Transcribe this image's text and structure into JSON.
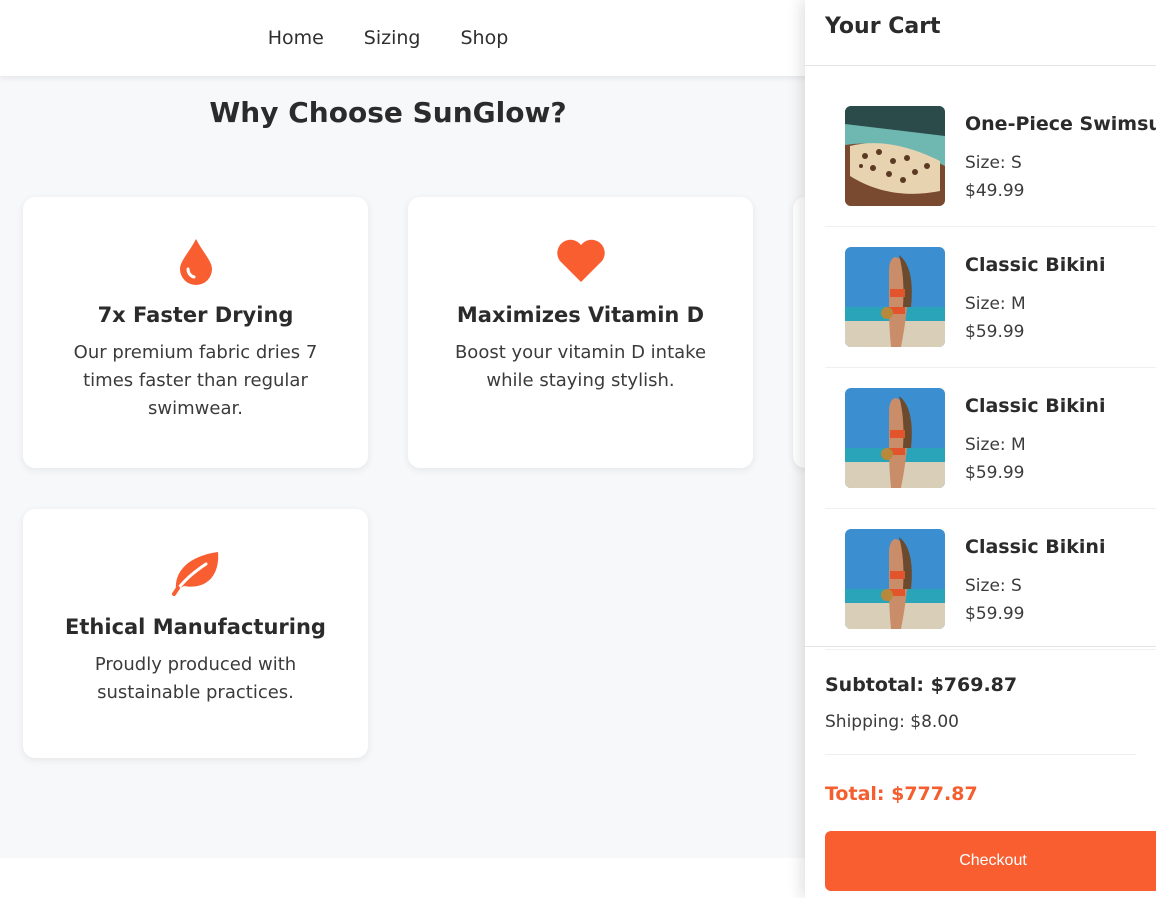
{
  "colors": {
    "accent": "#f95e31",
    "background": "#f7f8fa",
    "card": "#ffffff"
  },
  "nav": {
    "items": [
      {
        "label": "Home"
      },
      {
        "label": "Sizing"
      },
      {
        "label": "Shop"
      }
    ]
  },
  "features": {
    "title": "Why Choose SunGlow?",
    "cards": [
      {
        "icon": "water-drop-icon",
        "title": "7x Faster Drying",
        "text": "Our premium fabric dries 7 times faster than regular swimwear."
      },
      {
        "icon": "heart-icon",
        "title": "Maximizes Vitamin D",
        "text": "Boost your vitamin D intake while staying stylish."
      },
      {
        "icon": "leaf-icon",
        "title": "Ethical Manufacturing",
        "text": "Proudly produced with sustainable practices."
      }
    ]
  },
  "cart": {
    "title": "Your Cart",
    "items": [
      {
        "name": "One-Piece Swimsuit",
        "size": "Size: S",
        "price": "$49.99",
        "image": "leopard-swimsuit-photo"
      },
      {
        "name": "Classic Bikini",
        "size": "Size: M",
        "price": "$59.99",
        "image": "beach-bikini-photo"
      },
      {
        "name": "Classic Bikini",
        "size": "Size: M",
        "price": "$59.99",
        "image": "beach-bikini-photo"
      },
      {
        "name": "Classic Bikini",
        "size": "Size: S",
        "price": "$59.99",
        "image": "beach-bikini-photo"
      }
    ],
    "subtotal": "Subtotal: $769.87",
    "shipping": "Shipping: $8.00",
    "total": "Total: $777.87",
    "checkout_label": "Checkout"
  }
}
